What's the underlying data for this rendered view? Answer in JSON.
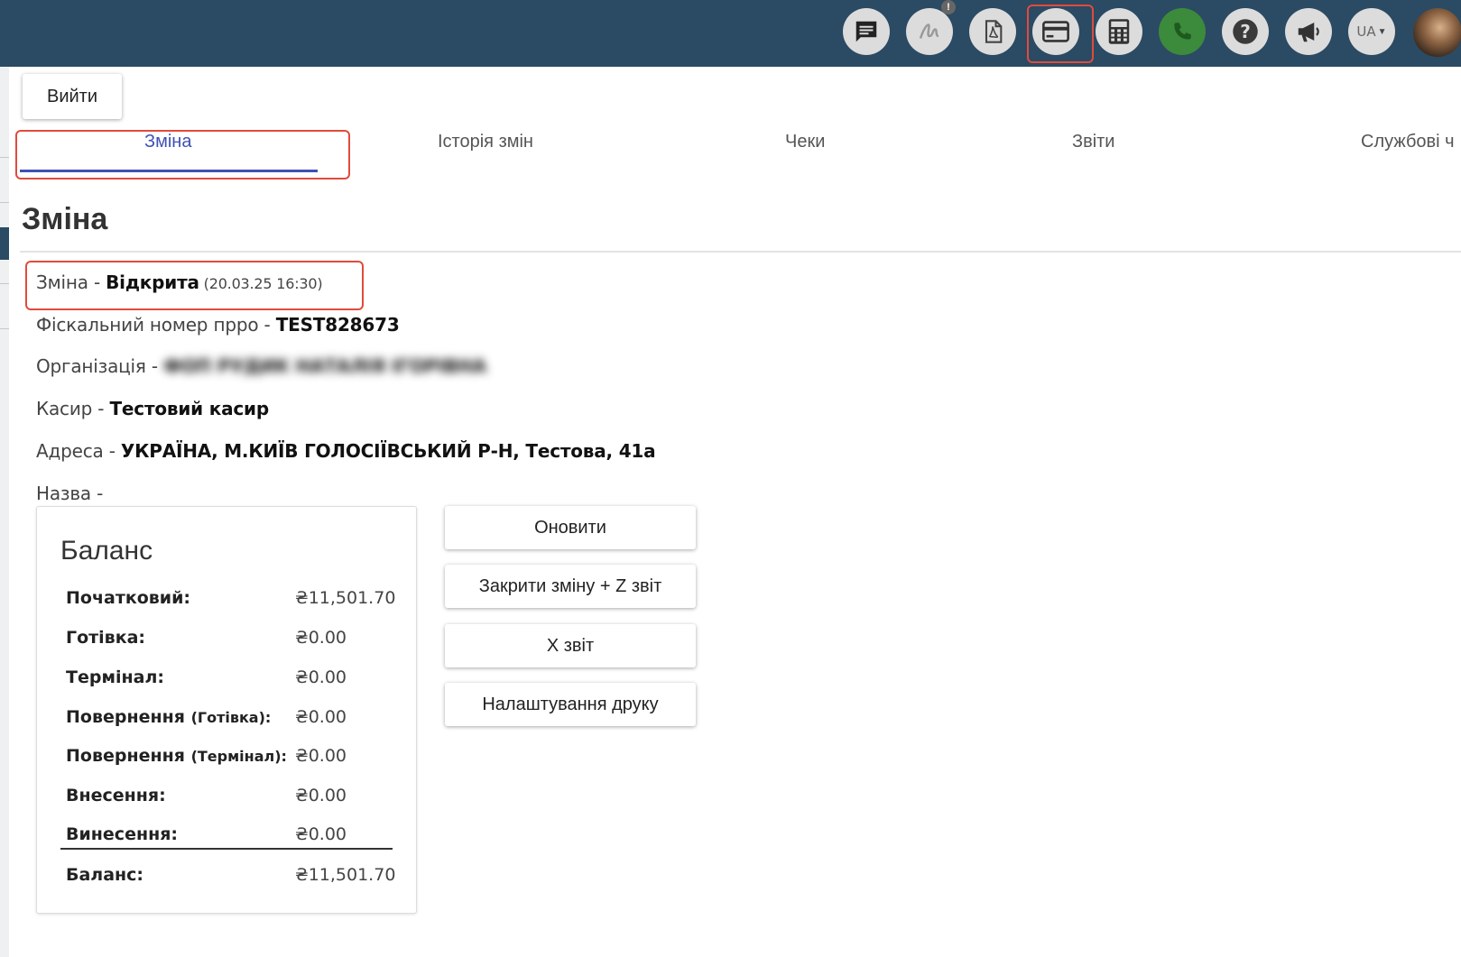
{
  "header": {
    "notification_badge": "!",
    "language": "UA",
    "icons": [
      "chat-icon",
      "signature-icon",
      "pdf-icon",
      "credit-card-icon",
      "calculator-icon",
      "phone-icon",
      "help-icon",
      "megaphone-icon"
    ]
  },
  "exit_button": "Вийти",
  "tabs": [
    {
      "label": "Зміна",
      "active": true
    },
    {
      "label": "Історія змін",
      "active": false
    },
    {
      "label": "Чеки",
      "active": false
    },
    {
      "label": "Звіти",
      "active": false
    },
    {
      "label": "Службові ч",
      "active": false
    }
  ],
  "page_title": "Зміна",
  "info": {
    "shift_label": "Зміна - ",
    "shift_status": "Відкрита",
    "shift_time": " (20.03.25 16:30)",
    "fiscal_label": "Фіскальний номер прро - ",
    "fiscal_value": "TEST828673",
    "org_label": "Організація - ",
    "org_value": "ФОП РУДИК НАТАЛІЯ ІГОРІВНА",
    "cashier_label": "Касир - ",
    "cashier_value": "Тестовий касир",
    "address_label": "Адреса - ",
    "address_value": "УКРАЇНА, М.КИЇВ ГОЛОСІЇВСЬКИЙ Р-Н, Тестова, 41а",
    "name_label": "Назва - "
  },
  "balance": {
    "title": "Баланс",
    "rows": [
      {
        "label": "Початковий:",
        "sub": "",
        "value": "₴11,501.70"
      },
      {
        "label": "Готівка:",
        "sub": "",
        "value": "₴0.00"
      },
      {
        "label": "Термінал:",
        "sub": "",
        "value": "₴0.00"
      },
      {
        "label": "Повернення ",
        "sub": "(Готівка):",
        "value": "₴0.00"
      },
      {
        "label": "Повернення ",
        "sub": "(Термінал):",
        "value": "₴0.00"
      },
      {
        "label": "Внесення:",
        "sub": "",
        "value": "₴0.00"
      },
      {
        "label": "Винесення:",
        "sub": "",
        "value": "₴0.00"
      }
    ],
    "total_label": "Баланс:",
    "total_value": "₴11,501.70"
  },
  "actions": {
    "refresh": "Оновити",
    "close_shift": "Закрити зміну + Z звіт",
    "x_report": "X звіт",
    "print_settings": "Налаштування друку"
  },
  "colors": {
    "header_bg": "#2b4a63",
    "accent": "#3f51b5",
    "highlight": "#e04b3c",
    "phone_green": "#3c8a3c"
  }
}
